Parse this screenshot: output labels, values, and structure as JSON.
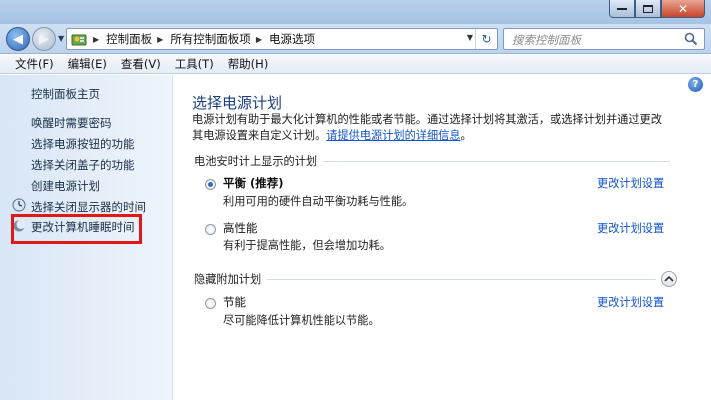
{
  "nav": {
    "breadcrumbs": [
      "控制面板",
      "所有控制面板项",
      "电源选项"
    ],
    "search_placeholder": "搜索控制面板"
  },
  "window": {
    "close_glyph": "✕"
  },
  "menu": {
    "items": [
      "文件(F)",
      "编辑(E)",
      "查看(V)",
      "工具(T)",
      "帮助(H)"
    ]
  },
  "sidebar": {
    "home": "控制面板主页",
    "links": [
      "唤醒时需要密码",
      "选择电源按钮的功能",
      "选择关闭盖子的功能",
      "创建电源计划",
      "选择关闭显示器的时间",
      "更改计算机睡眠时间"
    ]
  },
  "main": {
    "help_glyph": "?",
    "heading": "选择电源计划",
    "description": "电源计划有助于最大化计算机的性能或者节能。通过选择计划将其激活，或选择计划并通过更改其电源设置来自定义计划。",
    "description_link": "请提供电源计划的详细信息",
    "description_end": "。",
    "section_battery": "电池安时计上显示的计划",
    "section_hidden": "隐藏附加计划",
    "plans": [
      {
        "name": "平衡 (推荐)",
        "desc": "利用可用的硬件自动平衡功耗与性能。",
        "change": "更改计划设置",
        "selected": true
      },
      {
        "name": "高性能",
        "desc": "有利于提高性能，但会增加功耗。",
        "change": "更改计划设置",
        "selected": false
      },
      {
        "name": "节能",
        "desc": "尽可能降低计算机性能以节能。",
        "change": "更改计划设置",
        "selected": false
      }
    ]
  },
  "colors": {
    "heading": "#1a3f7e",
    "link": "#1155cc",
    "highlight_box": "#e21818"
  }
}
